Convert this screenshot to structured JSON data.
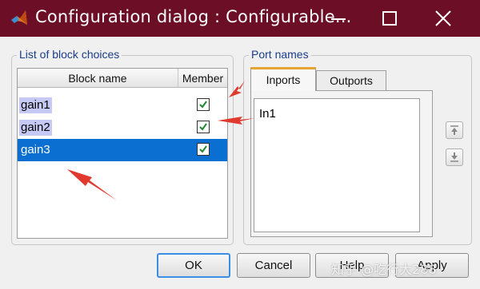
{
  "window": {
    "title": "Configuration dialog : Configurable...",
    "app_icon": "matlab-icon",
    "controls": {
      "minimize": "minimize-icon",
      "maximize": "maximize-icon",
      "close": "close-icon"
    },
    "title_bar_color": "#6b0e26"
  },
  "block_choices": {
    "group_title": "List of block choices",
    "columns": [
      "Block name",
      "Member"
    ],
    "rows": [
      {
        "name": "gain1",
        "member": true,
        "selected": false
      },
      {
        "name": "gain2",
        "member": true,
        "selected": false
      },
      {
        "name": "gain3",
        "member": true,
        "selected": true
      }
    ],
    "selection_color": "#0a6fd1"
  },
  "port_names": {
    "group_title": "Port names",
    "tabs": [
      {
        "label": "Inports",
        "active": true
      },
      {
        "label": "Outports",
        "active": false
      }
    ],
    "ports": [
      "In1"
    ],
    "move_up_icon": "move-up-icon",
    "move_down_icon": "move-down-icon"
  },
  "buttons": {
    "ok": "OK",
    "cancel": "Cancel",
    "help": "Help",
    "apply": "Apply"
  },
  "watermark": "知乎 @吃行大288",
  "annotation_color": "#e03a2f"
}
